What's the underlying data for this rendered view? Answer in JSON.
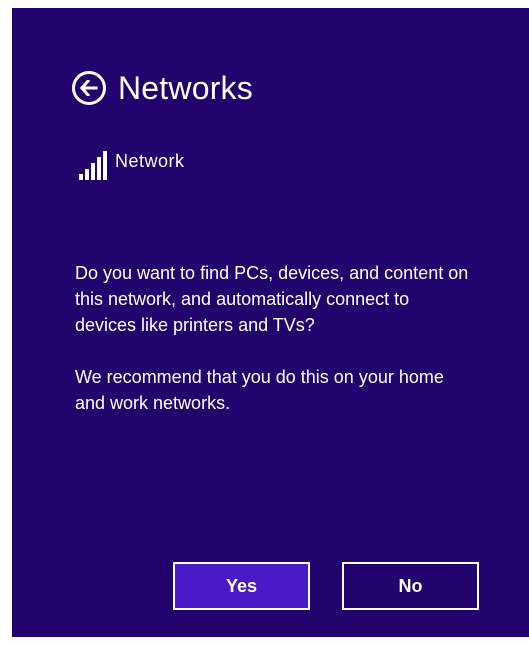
{
  "header": {
    "title": "Networks",
    "back_icon": "back-arrow-icon"
  },
  "network": {
    "name": "Network",
    "signal_icon": "wifi-signal-icon"
  },
  "message": {
    "paragraph_1": "Do you want to find PCs, devices, and content on this network, and automatically connect to devices like printers and TVs?",
    "paragraph_2": "We recommend that you do this on your home and work networks."
  },
  "buttons": {
    "yes_label": "Yes",
    "no_label": "No"
  },
  "colors": {
    "background": "#22026c",
    "accent": "#4a19c8",
    "text": "#ffffff"
  }
}
